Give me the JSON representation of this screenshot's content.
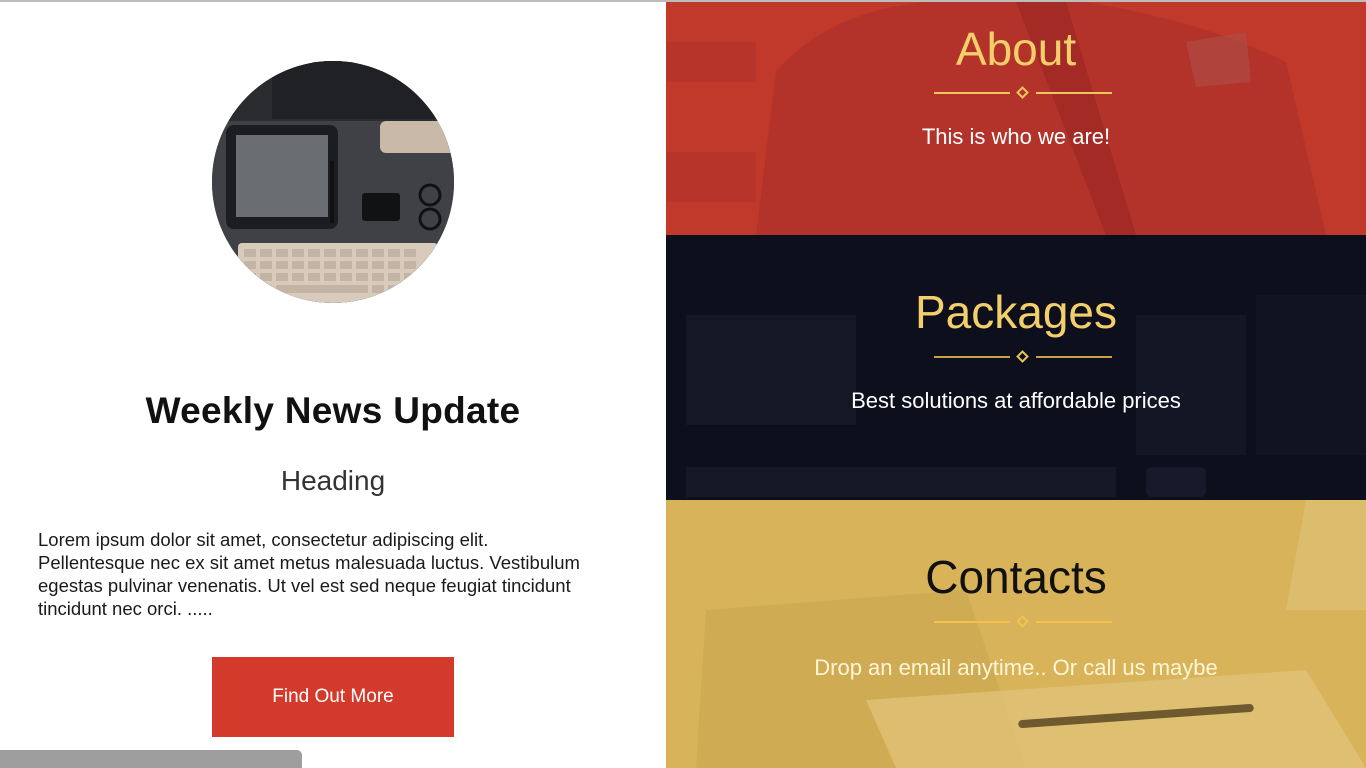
{
  "left": {
    "news_title": "Weekly News Update",
    "heading": "Heading",
    "body": "Lorem ipsum dolor sit amet, consectetur adipiscing elit. Pellentesque nec ex sit amet metus malesuada luctus. Vestibulum egestas pulvinar venenatis. Ut vel est sed neque feugiat tincidunt tincidunt nec orci. .....",
    "cta_label": "Find Out More",
    "photo_icon": "desk-workspace-image"
  },
  "panels": [
    {
      "title": "About",
      "subtitle": "This is who we are!",
      "bg_color": "#c0392b"
    },
    {
      "title": "Packages",
      "subtitle": "Best solutions at affordable prices",
      "bg_color": "#0d0f1c"
    },
    {
      "title": "Contacts",
      "subtitle": "Drop an email anytime.. Or call us maybe",
      "bg_color": "#d8b35a"
    }
  ],
  "colors": {
    "accent_gold": "#f3cf6c",
    "cta_red": "#d33a2c"
  }
}
